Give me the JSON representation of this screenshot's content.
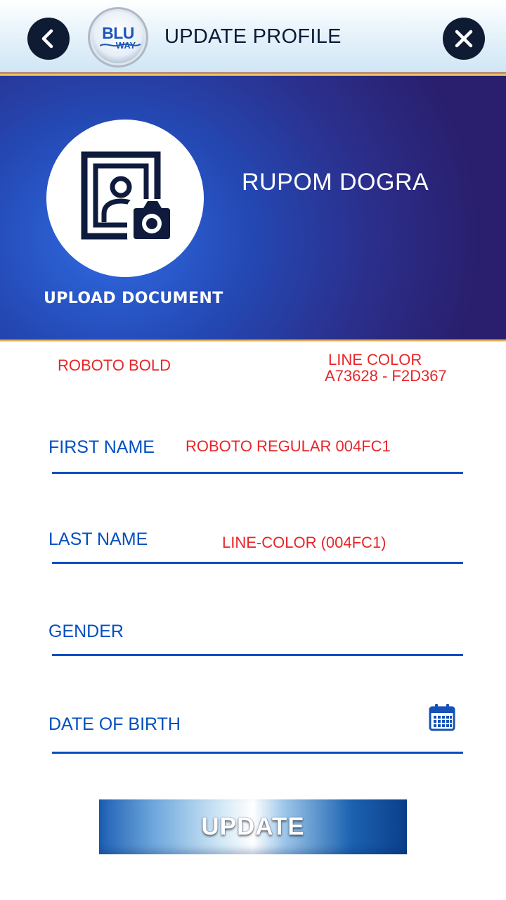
{
  "header": {
    "title": "UPDATE PROFILE",
    "back_icon": "chevron-left-icon",
    "close_icon": "close-icon",
    "logo": {
      "line1": "BLU",
      "line2": "WAY"
    }
  },
  "profile": {
    "name": "RUPOM DOGRA",
    "upload_label": "UPLOAD DOCUMENT",
    "upload_icon": "photo-camera-icon"
  },
  "annotations": {
    "font_note": "ROBOTO BOLD",
    "line_color_title": "LINE COLOR",
    "line_color_values": "A73628 - F2D367",
    "field_font_note": "ROBOTO REGULAR 004FC1",
    "field_line_note": "LINE-COLOR (004FC1)"
  },
  "form": {
    "first_name_label": "FIRST NAME",
    "last_name_label": "LAST NAME",
    "gender_label": "GENDER",
    "dob_label": "DATE OF BIRTH",
    "calendar_icon": "calendar-icon"
  },
  "actions": {
    "update_label": "UPDATE"
  },
  "colors": {
    "field_text": "#004fc1",
    "field_line": "#004fc1",
    "accent_line_start": "#a73628",
    "accent_line_end": "#f2d367",
    "annotation": "#e8262a",
    "header_button": "#0f1b33"
  }
}
